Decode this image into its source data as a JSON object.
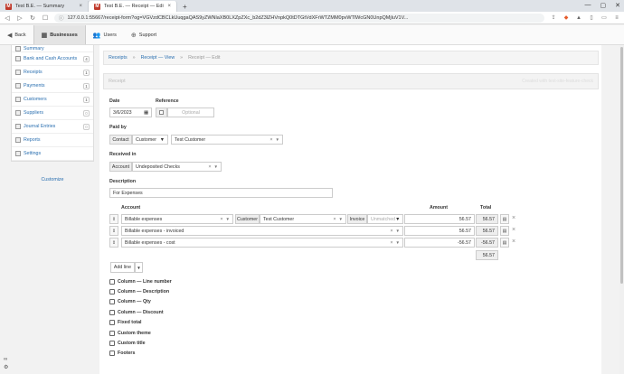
{
  "browser": {
    "tabs": [
      {
        "label": "Test B.E. — Summary",
        "active": false
      },
      {
        "label": "Test B.E. — Receipt — Edit",
        "active": true
      }
    ],
    "favicon_text": "M",
    "url": "127.0.0.1:55667/receipt-form?og=VGVzdCBCLkUuqgaQAS9yZWNlaXB0LXZpZXc_b2dZ3lZHVnpkQ0tDTGtVdXFrWTZMM0pvWTlWcGN0UnpQMjluV1V..."
  },
  "appnav": {
    "back": "Back",
    "businesses": "Businesses",
    "users": "Users",
    "support": "Support"
  },
  "sidebar": {
    "items": [
      {
        "label": "Summary",
        "badge": ""
      },
      {
        "label": "Bank and Cash Accounts",
        "badge": "4"
      },
      {
        "label": "Receipts",
        "badge": "1"
      },
      {
        "label": "Payments",
        "badge": "1"
      },
      {
        "label": "Customers",
        "badge": "1"
      },
      {
        "label": "Suppliers",
        "badge": "0"
      },
      {
        "label": "Journal Entries",
        "badge": "0"
      },
      {
        "label": "Reports",
        "badge": ""
      },
      {
        "label": "Settings",
        "badge": ""
      }
    ],
    "customize": "Customize"
  },
  "breadcrumb": {
    "receipts": "Receipts",
    "view": "Receipt — View",
    "edit": "Receipt — Edit",
    "sep": "»"
  },
  "panel": {
    "title": "Receipt",
    "right_note": "Created with test-site-feature-check"
  },
  "form": {
    "date_label": "Date",
    "date_value": "3/6/2023",
    "reference_label": "Reference",
    "reference_placeholder": "Optional",
    "paid_by_label": "Paid by",
    "contact_addon": "Contact",
    "contact_type": "Customer",
    "contact_value": "Test Customer",
    "received_in_label": "Received in",
    "account_addon": "Account",
    "received_in_value": "Undeposited Checks",
    "description_label": "Description",
    "description_value": "For Expenses"
  },
  "lines": {
    "headers": {
      "account": "Account",
      "amount": "Amount",
      "total": "Total"
    },
    "customer_addon": "Customer",
    "invoice_addon": "Invoice",
    "invoice_placeholder": "Unmatched",
    "rows": [
      {
        "account": "Billable expenses",
        "customer": "Test Customer",
        "amount": "56.57",
        "total": "56.57"
      },
      {
        "account": "Billable expenses - invoiced",
        "amount": "56.57",
        "total": "56.57"
      },
      {
        "account": "Billable expenses - cost",
        "amount": "-56.57",
        "total": "-56.57"
      }
    ],
    "grand_total": "56.57",
    "add_line": "Add line"
  },
  "options": [
    "Column — Line number",
    "Column — Description",
    "Column — Qty",
    "Column — Discount",
    "Fixed total",
    "Custom theme",
    "Custom title",
    "Footers"
  ]
}
